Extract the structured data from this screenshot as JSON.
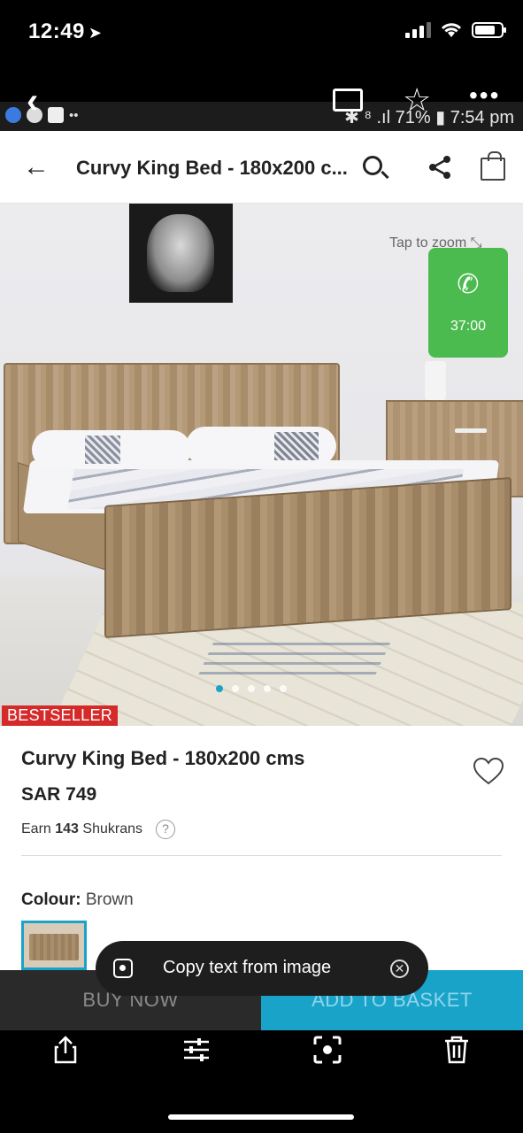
{
  "ios_status": {
    "time": "12:49",
    "location_glyph": "➤"
  },
  "android_status": {
    "right_text": "✱ ⁸ .ıl 71% ▮ 7:54 pm",
    "left_glyphs": "••"
  },
  "viewer": {
    "back_glyph": "‹",
    "star_glyph": "☆",
    "more_glyph": "•••"
  },
  "header": {
    "title": "Curvy King Bed - 180x200 c...",
    "back_glyph": "←",
    "icons": [
      "search-icon",
      "share-icon",
      "bag-icon"
    ]
  },
  "product_image": {
    "zoom_hint": "Tap to zoom ⤡",
    "call_time": "37:00",
    "call_glyph": "✆",
    "carousel_dots": 5,
    "active_dot": 0,
    "badge": "BESTSELLER"
  },
  "product": {
    "title": "Curvy King Bed - 180x200 cms",
    "price": "SAR 749",
    "earn_prefix": "Earn",
    "earn_amount": "143",
    "earn_suffix": "Shukrans",
    "help_glyph": "?",
    "colour_label": "Colour:",
    "colour_value": "Brown"
  },
  "actions": {
    "buy_now": "BUY NOW",
    "add_to_basket": "ADD TO BASKET"
  },
  "toast": {
    "text": "Copy text from image",
    "close_glyph": "✕"
  },
  "toolbar": {
    "icons": [
      "share-out-icon",
      "adjust-icon",
      "scan-text-icon",
      "trash-icon"
    ]
  },
  "colors": {
    "accent": "#1aa3c9",
    "badge": "#d42a2a",
    "call": "#4cbb4f"
  }
}
